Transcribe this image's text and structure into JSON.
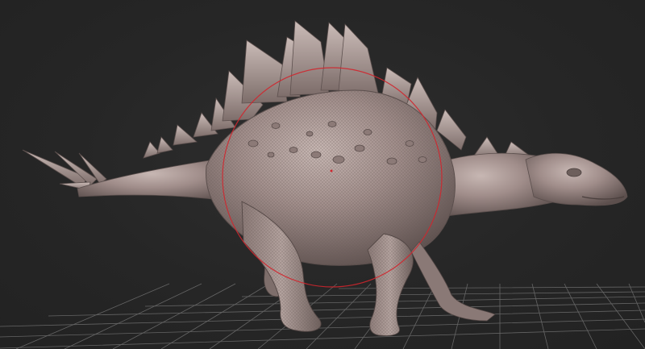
{
  "viewport": {
    "background": "#262626",
    "grid_color": "#7a7a7a",
    "model_color": "#9a8784",
    "model_highlight": "#c2b2ae",
    "model_shadow": "#5f5250",
    "gizmo_color": "#d0262e",
    "model_name_icon": "stegosaurus-model"
  }
}
